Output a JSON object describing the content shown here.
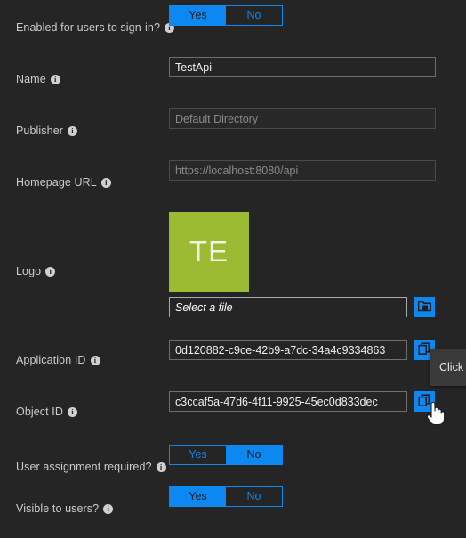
{
  "form": {
    "rows": [
      {
        "id": "enabled-signin",
        "label": "Enabled for users to sign-in?",
        "type": "toggle",
        "options": [
          "Yes",
          "No"
        ],
        "selected": "Yes"
      },
      {
        "id": "name",
        "label": "Name",
        "type": "text",
        "value": "TestApi",
        "disabled": false
      },
      {
        "id": "publisher",
        "label": "Publisher",
        "type": "text",
        "value": "Default Directory",
        "disabled": true
      },
      {
        "id": "homepage-url",
        "label": "Homepage URL",
        "type": "text",
        "value": "https://localhost:8080/api",
        "disabled": true
      },
      {
        "id": "logo",
        "label": "Logo",
        "type": "logo",
        "initials": "TE",
        "file_placeholder": "Select a file",
        "browse_icon": "folder-icon",
        "tile_color": "#9cba32"
      },
      {
        "id": "application-id",
        "label": "Application ID",
        "type": "copyable",
        "value": "0d120882-c9ce-42b9-a7dc-34a4c9334863",
        "copy_icon": "copy-icon"
      },
      {
        "id": "object-id",
        "label": "Object ID",
        "type": "copyable",
        "value": "c3ccaf5a-47d6-4f11-9925-45ec0d833dec",
        "copy_icon": "copy-icon"
      },
      {
        "id": "user-assignment-required",
        "label": "User assignment required?",
        "type": "toggle",
        "options": [
          "Yes",
          "No"
        ],
        "selected": "No"
      },
      {
        "id": "visible-to-users",
        "label": "Visible to users?",
        "type": "toggle",
        "options": [
          "Yes",
          "No"
        ],
        "selected": "Yes"
      }
    ]
  },
  "tooltip": {
    "text": "Click t"
  },
  "colors": {
    "accent": "#0c88f0",
    "background": "#252525",
    "label": "#cccccc",
    "logo_tile": "#9cba32",
    "field_border": "#6e6e6e"
  },
  "icons": {
    "info": "i",
    "cursor": "pointer-hand-cursor"
  }
}
